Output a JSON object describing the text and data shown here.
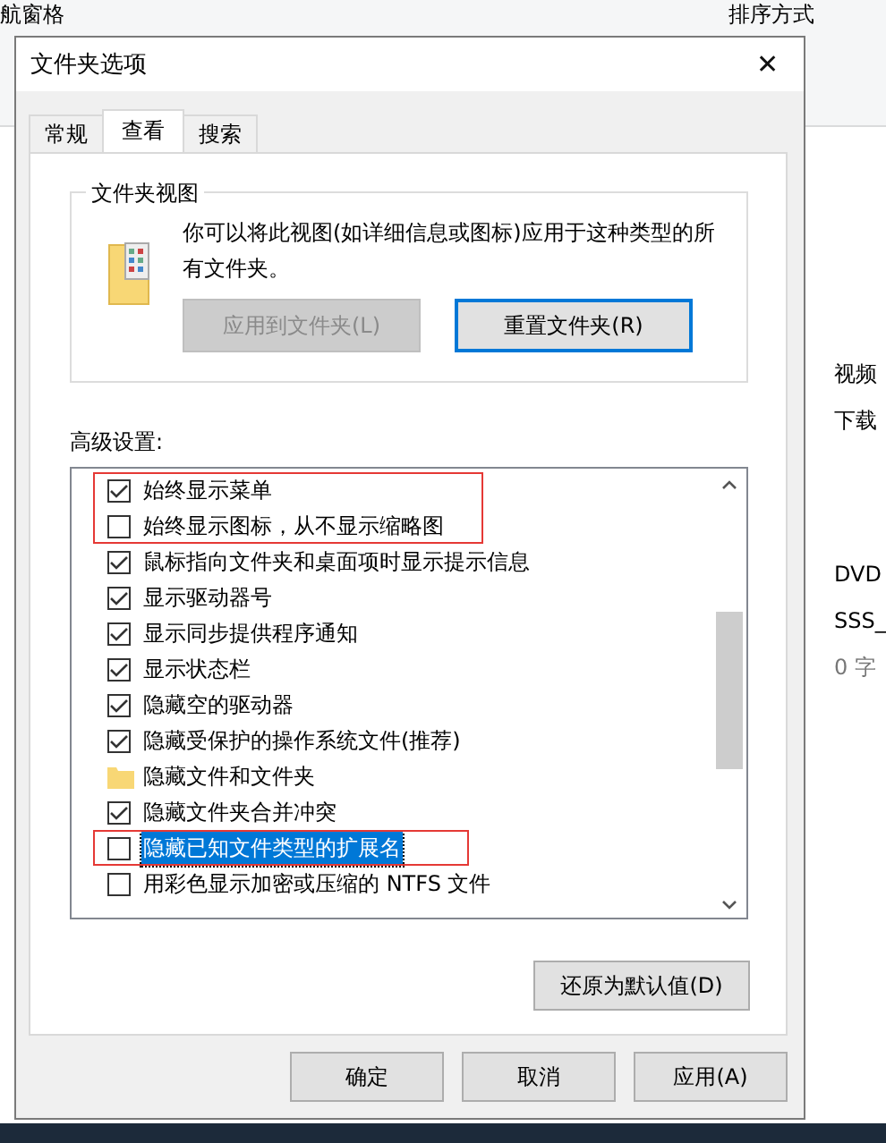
{
  "background": {
    "texts": [
      {
        "text": "航窗格",
        "kind": "top-left"
      },
      {
        "text": "排序方式",
        "kind": "top-right"
      },
      {
        "text": "视频",
        "kind": "side"
      },
      {
        "text": "下载",
        "kind": "side"
      },
      {
        "text": "DVD",
        "kind": "side"
      },
      {
        "text": "SSS_",
        "kind": "side"
      },
      {
        "text": "0 字",
        "kind": "muted"
      }
    ]
  },
  "window": {
    "title": "文件夹选项",
    "close": "✕"
  },
  "tabs": [
    {
      "label": "常规",
      "selected": false
    },
    {
      "label": "查看",
      "selected": true
    },
    {
      "label": "搜索",
      "selected": false
    }
  ],
  "folder_views": {
    "title": "文件夹视图",
    "description": "你可以将此视图(如详细信息或图标)应用于这种类型的所有文件夹。",
    "buttons": [
      {
        "label": "应用到文件夹(L)",
        "disabled": true,
        "default": false
      },
      {
        "label": "重置文件夹(R)",
        "disabled": false,
        "default": true
      }
    ]
  },
  "advanced": {
    "label": "高级设置:",
    "items": [
      {
        "kind": "checkbox",
        "label": "始终显示菜单",
        "checked": true,
        "selected": false,
        "marked": true
      },
      {
        "kind": "checkbox",
        "label": "始终显示图标，从不显示缩略图",
        "checked": false,
        "selected": false,
        "marked": true
      },
      {
        "kind": "checkbox",
        "label": "鼠标指向文件夹和桌面项时显示提示信息",
        "checked": true,
        "selected": false,
        "marked": false
      },
      {
        "kind": "checkbox",
        "label": "显示驱动器号",
        "checked": true,
        "selected": false,
        "marked": false
      },
      {
        "kind": "checkbox",
        "label": "显示同步提供程序通知",
        "checked": true,
        "selected": false,
        "marked": false
      },
      {
        "kind": "checkbox",
        "label": "显示状态栏",
        "checked": true,
        "selected": false,
        "marked": false
      },
      {
        "kind": "checkbox",
        "label": "隐藏空的驱动器",
        "checked": true,
        "selected": false,
        "marked": false
      },
      {
        "kind": "checkbox",
        "label": "隐藏受保护的操作系统文件(推荐)",
        "checked": true,
        "selected": false,
        "marked": false
      },
      {
        "kind": "folder",
        "label": "隐藏文件和文件夹",
        "selected": false,
        "marked": false
      },
      {
        "kind": "checkbox",
        "label": "隐藏文件夹合并冲突",
        "checked": true,
        "selected": false,
        "marked": false
      },
      {
        "kind": "checkbox",
        "label": "隐藏已知文件类型的扩展名",
        "checked": false,
        "selected": true,
        "marked": true
      },
      {
        "kind": "checkbox",
        "label": "用彩色显示加密或压缩的 NTFS 文件",
        "checked": false,
        "selected": false,
        "marked": false
      }
    ],
    "restore": "还原为默认值(D)"
  },
  "buttons": [
    "确定",
    "取消",
    "应用(A)"
  ]
}
